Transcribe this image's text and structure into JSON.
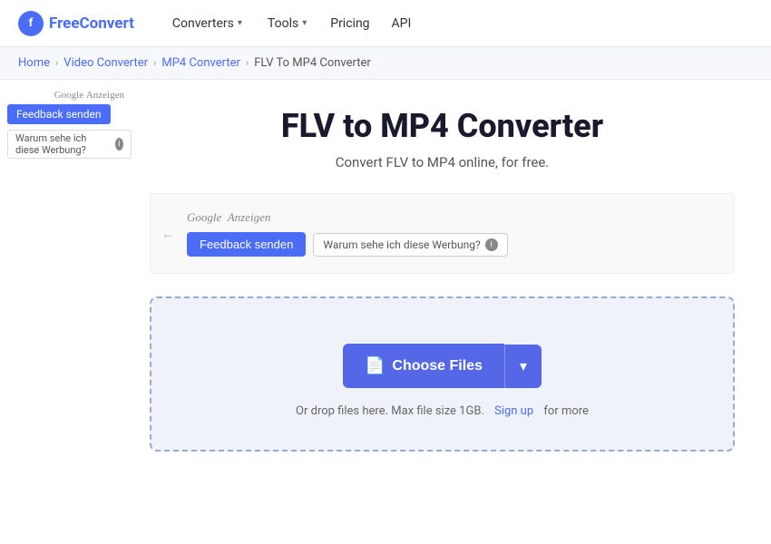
{
  "logo": {
    "symbol": "f",
    "text_free": "Free",
    "text_convert": "Convert"
  },
  "nav": {
    "converters_label": "Converters",
    "tools_label": "Tools",
    "pricing_label": "Pricing",
    "api_label": "API"
  },
  "breadcrumb": {
    "home": "Home",
    "video_converter": "Video Converter",
    "mp4_converter": "MP4 Converter",
    "current": "FLV To MP4 Converter"
  },
  "page": {
    "title": "FLV to MP4 Converter",
    "subtitle": "Convert FLV to MP4 online, for free."
  },
  "sidebar_ad": {
    "google_label": "Google",
    "anzeigen": "Anzeigen",
    "feedback_btn": "Feedback senden",
    "why_text": "Warum sehe ich diese Werbung?"
  },
  "center_ad": {
    "google_label": "Google",
    "anzeigen": "Anzeigen",
    "feedback_btn": "Feedback senden",
    "why_text": "Warum sehe ich diese Werbung?"
  },
  "dropzone": {
    "choose_files_label": "Choose Files",
    "dropdown_label": "▾",
    "info_text": "Or drop files here. Max file size 1GB.",
    "signup_text": "Sign up",
    "info_suffix": "for more"
  }
}
